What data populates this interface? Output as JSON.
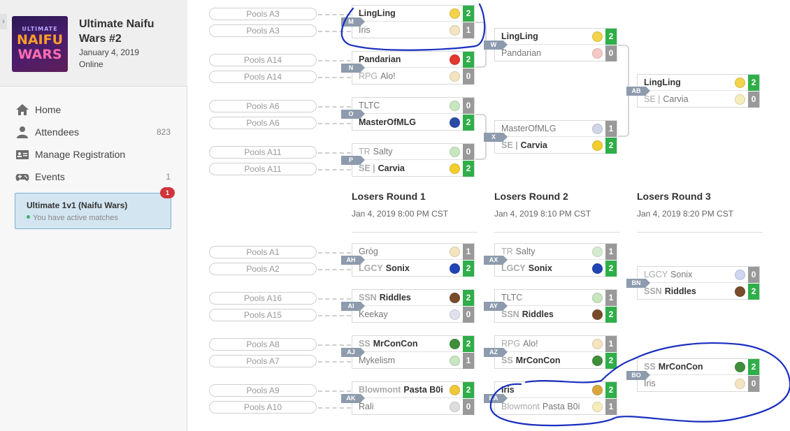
{
  "sidebar": {
    "collapse_glyph": "›",
    "tournament": {
      "name": "Ultimate Naifu Wars #2",
      "date": "January 4, 2019",
      "location": "Online",
      "logo": {
        "line1": "ULTIMATE",
        "line2": "NAIFU",
        "line3": "WARS"
      }
    },
    "nav": [
      {
        "label": "Home",
        "icon": "home-icon",
        "count": ""
      },
      {
        "label": "Attendees",
        "icon": "user-icon",
        "count": "823"
      },
      {
        "label": "Manage Registration",
        "icon": "id-card-icon",
        "count": ""
      },
      {
        "label": "Events",
        "icon": "gamepad-icon",
        "count": "1"
      }
    ],
    "event_card": {
      "title": "Ultimate 1v1 (Naifu Wars)",
      "status": "You have active matches",
      "notification_count": "1"
    }
  },
  "rounds": [
    {
      "name": "Losers Round 1",
      "time": "Jan 4, 2019 8:00 PM CST"
    },
    {
      "name": "Losers Round 2",
      "time": "Jan 4, 2019 8:10 PM CST"
    },
    {
      "name": "Losers Round 3",
      "time": "Jan 4, 2019 8:20 PM CST"
    }
  ],
  "winners_matches": [
    {
      "id": "M",
      "pools": [
        "Pools A3",
        "Pools A3"
      ],
      "players": [
        {
          "prefix": "",
          "name": "LingLing",
          "score": "2",
          "winner": true,
          "avatar": "#f2d34a"
        },
        {
          "prefix": "",
          "name": "Iris",
          "score": "1",
          "winner": false,
          "avatar": "#f4e4bf"
        }
      ]
    },
    {
      "id": "N",
      "pools": [
        "Pools A14",
        "Pools A14"
      ],
      "players": [
        {
          "prefix": "",
          "name": "Pandarian",
          "score": "2",
          "winner": true,
          "avatar": "#e2382f"
        },
        {
          "prefix": "RPG",
          "name": "Alo!",
          "score": "0",
          "winner": false,
          "avatar": "#f4e4bf"
        }
      ]
    },
    {
      "id": "O",
      "pools": [
        "Pools A6",
        "Pools A6"
      ],
      "players": [
        {
          "prefix": "",
          "name": "TLTC",
          "score": "0",
          "winner": false,
          "avatar": "#c8e6c0"
        },
        {
          "prefix": "",
          "name": "MasterOfMLG",
          "score": "2",
          "winner": true,
          "avatar": "#2a4aa8"
        }
      ]
    },
    {
      "id": "P",
      "pools": [
        "Pools A11",
        "Pools A11"
      ],
      "players": [
        {
          "prefix": "TR",
          "name": "Salty",
          "score": "0",
          "winner": false,
          "avatar": "#c8e6c0"
        },
        {
          "prefix": "SE |",
          "name": "Carvia",
          "score": "2",
          "winner": true,
          "avatar": "#f2cd2b"
        }
      ]
    },
    {
      "id": "W",
      "pools": [],
      "players": [
        {
          "prefix": "",
          "name": "LingLing",
          "score": "2",
          "winner": true,
          "avatar": "#f2d34a"
        },
        {
          "prefix": "",
          "name": "Pandarian",
          "score": "0",
          "winner": false,
          "avatar": "#f6c9c6"
        }
      ]
    },
    {
      "id": "X",
      "pools": [],
      "players": [
        {
          "prefix": "",
          "name": "MasterOfMLG",
          "score": "1",
          "winner": false,
          "avatar": "#cfd6ea"
        },
        {
          "prefix": "SE |",
          "name": "Carvia",
          "score": "2",
          "winner": true,
          "avatar": "#f2cd2b"
        }
      ]
    },
    {
      "id": "AB",
      "pools": [],
      "players": [
        {
          "prefix": "",
          "name": "LingLing",
          "score": "2",
          "winner": true,
          "avatar": "#f2d34a"
        },
        {
          "prefix": "SE |",
          "name": "Carvia",
          "score": "0",
          "winner": false,
          "avatar": "#f6edbd"
        }
      ]
    }
  ],
  "losers_matches": [
    {
      "id": "AH",
      "pools": [
        "Pools A1",
        "Pools A2"
      ],
      "players": [
        {
          "prefix": "",
          "name": "Gróg",
          "score": "1",
          "winner": false,
          "avatar": "#f4e4bf"
        },
        {
          "prefix": "LGCY",
          "name": "Sonix",
          "score": "2",
          "winner": true,
          "avatar": "#2046b5"
        }
      ]
    },
    {
      "id": "AI",
      "pools": [
        "Pools A16",
        "Pools A15"
      ],
      "players": [
        {
          "prefix": "SSN",
          "name": "Riddles",
          "score": "2",
          "winner": true,
          "avatar": "#7a4b2a"
        },
        {
          "prefix": "",
          "name": "Keekay",
          "score": "0",
          "winner": false,
          "avatar": "#dfe2ee"
        }
      ]
    },
    {
      "id": "AJ",
      "pools": [
        "Pools A8",
        "Pools A7"
      ],
      "players": [
        {
          "prefix": "SS",
          "name": "MrConCon",
          "score": "2",
          "winner": true,
          "avatar": "#3f8f3a"
        },
        {
          "prefix": "",
          "name": "Mykelism",
          "score": "1",
          "winner": false,
          "avatar": "#c8e6c0"
        }
      ]
    },
    {
      "id": "AK",
      "pools": [
        "Pools A9",
        "Pools A10"
      ],
      "players": [
        {
          "prefix": "Blowmont",
          "name": "Pasta B0i",
          "score": "2",
          "winner": true,
          "avatar": "#f2c73a"
        },
        {
          "prefix": "",
          "name": "Rali",
          "score": "0",
          "winner": false,
          "avatar": "#dddddd"
        }
      ]
    },
    {
      "id": "AX",
      "pools": [],
      "players": [
        {
          "prefix": "TR",
          "name": "Salty",
          "score": "1",
          "winner": false,
          "avatar": "#d6ecd0"
        },
        {
          "prefix": "LGCY",
          "name": "Sonix",
          "score": "2",
          "winner": true,
          "avatar": "#2046b5"
        }
      ]
    },
    {
      "id": "AY",
      "pools": [],
      "players": [
        {
          "prefix": "",
          "name": "TLTC",
          "score": "1",
          "winner": false,
          "avatar": "#c8e6c0"
        },
        {
          "prefix": "SSN",
          "name": "Riddles",
          "score": "2",
          "winner": true,
          "avatar": "#7a4b2a"
        }
      ]
    },
    {
      "id": "AZ",
      "pools": [],
      "players": [
        {
          "prefix": "RPG",
          "name": "Alo!",
          "score": "1",
          "winner": false,
          "avatar": "#f4e4bf"
        },
        {
          "prefix": "SS",
          "name": "MrConCon",
          "score": "2",
          "winner": true,
          "avatar": "#3f8f3a"
        }
      ]
    },
    {
      "id": "BA",
      "pools": [],
      "players": [
        {
          "prefix": "",
          "name": "Iris",
          "score": "2",
          "winner": true,
          "avatar": "#d9a73c"
        },
        {
          "prefix": "Blowmont",
          "name": "Pasta B0i",
          "score": "1",
          "winner": false,
          "avatar": "#f6edbd"
        }
      ]
    },
    {
      "id": "BN",
      "pools": [],
      "players": [
        {
          "prefix": "LGCY",
          "name": "Sonix",
          "score": "0",
          "winner": false,
          "avatar": "#cfd6f2"
        },
        {
          "prefix": "SSN",
          "name": "Riddles",
          "score": "2",
          "winner": true,
          "avatar": "#7a4b2a"
        }
      ]
    },
    {
      "id": "BO",
      "pools": [],
      "players": [
        {
          "prefix": "SS",
          "name": "MrConCon",
          "score": "2",
          "winner": true,
          "avatar": "#3f8f3a"
        },
        {
          "prefix": "",
          "name": "Iris",
          "score": "0",
          "winner": false,
          "avatar": "#f4e4bf"
        }
      ]
    }
  ],
  "colors": {
    "win_score": "#2fae49",
    "lose_score": "#999999",
    "tag": "#8d9bad",
    "annotation": "#1a2fbf"
  }
}
